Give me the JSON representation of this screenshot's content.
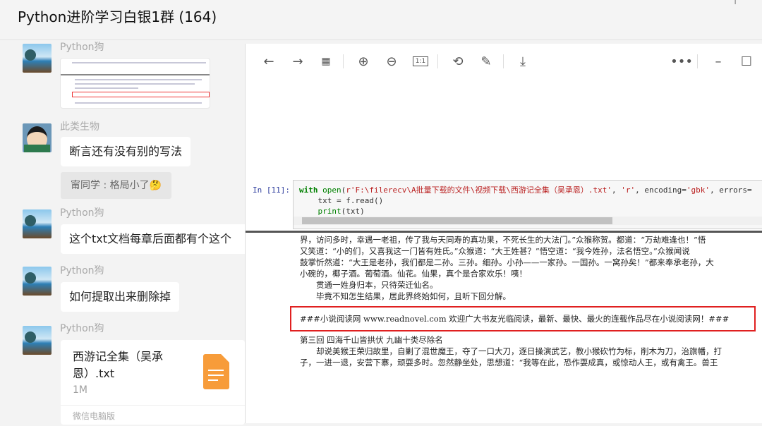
{
  "header": {
    "title": "Python进阶学习白银1群 (164)"
  },
  "messages": [
    {
      "sender": "Python狗",
      "type": "image"
    },
    {
      "sender": "此类生物",
      "text": "断言还有没有别的写法",
      "quote": "甯同学 : 格局小了🤔"
    },
    {
      "sender": "Python狗",
      "text": "这个txt文档每章后面都有个这个"
    },
    {
      "sender": "Python狗",
      "text": "如何提取出来删除掉"
    },
    {
      "sender": "Python狗",
      "type": "file",
      "file_name": "西游记全集（吴承恩）.txt",
      "file_size": "1M",
      "footer": "微信电脑版"
    }
  ],
  "viewer": {
    "toolbar": [
      "back",
      "forward",
      "grid",
      "zoom-in",
      "zoom-out",
      "actual-size",
      "rotate",
      "edit",
      "download",
      "more",
      "minimize",
      "maximize"
    ],
    "cell": {
      "prompt": "In  [11]:",
      "code_kw": "with",
      "code_open": "open",
      "code_line1_a": "(",
      "code_path": "r'F:\\filerecv\\A批量下载的文件\\视频下载\\西游记全集（吴承恩）.txt'",
      "code_line1_b": ", ",
      "code_mode": "'r'",
      "code_line1_c": ", encoding=",
      "code_enc": "'gbk'",
      "code_line1_d": ", errors=",
      "code_line2": "    txt = f.read()",
      "code_line3_fn": "print",
      "code_line3_rest": "(txt)"
    },
    "output": {
      "lines": [
        "界，访问多时，幸遇一老祖，传了我与天同寿的真功果，不死长生的大法门。”众猴称贺。都道：“万劫难逢也！”悟",
        "又笑道：“小的们，又喜我这一门皆有姓氏。”众猴道：“大王姓甚？”悟空道：“我今姓孙，法名悟空。”众猴闻说",
        "鼓掌忻然道：“大王是老孙，我们都是二孙。三孙。细孙。小孙——一家孙。一国孙。一窝孙矣！”都来奉承老孙，大",
        "小碗的，椰子酒。葡萄酒。仙花。仙果，真个是合家欢乐！咦！"
      ],
      "indented": [
        "贯通一姓身归本，只待荣迁仙名。",
        "毕竟不知怎生结果，居此界终始如何，且听下回分解。"
      ],
      "highlight": "###小说阅读网 www.readnovel.com 欢迎广大书友光临阅读，最新、最快、最火的连载作品尽在小说阅读网！###",
      "chapter": "第三回 四海千山皆拱伏 九幽十类尽除名",
      "after": [
        "却说美猴王荣归故里，自剿了混世魔王，夺了一口大刀，逐日操演武艺，教小猴砍竹为标，削木为刀，治旗幡，打",
        "子，一进一退，安营下寨，顽耍多时。忽然静坐处，思想道：“我等在此，恐作耍成真，或惊动人王，或有禽王。兽王"
      ]
    }
  }
}
